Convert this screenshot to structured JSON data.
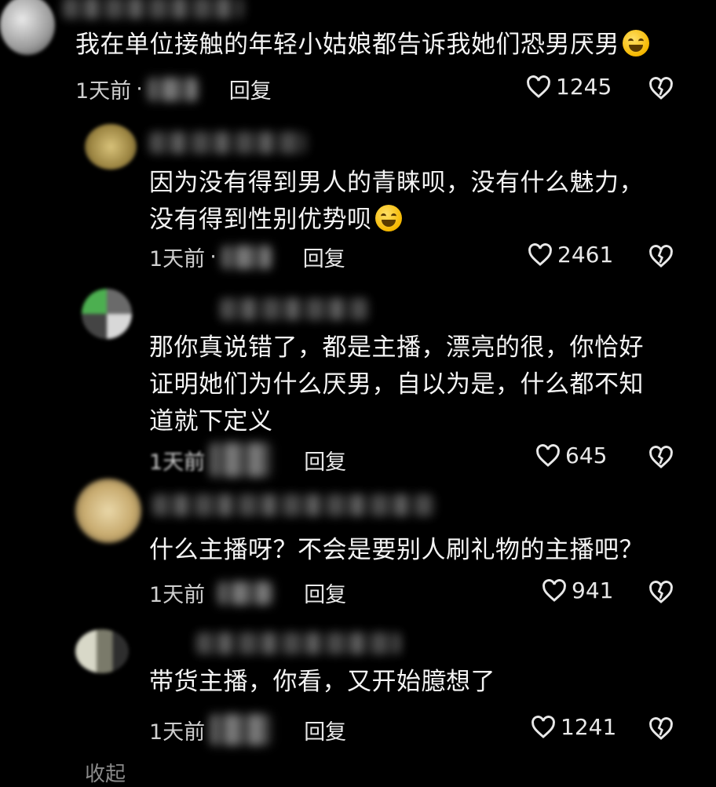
{
  "comments": [
    {
      "text_lines": [
        "我在单位接触的年轻小姑娘都告诉我她们恐男厌男"
      ],
      "emoji": "rofl-emoji",
      "time": "1天前",
      "reply": "回复",
      "likes": "1245"
    },
    {
      "text_lines": [
        "因为没有得到男人的青睐呗，没有什么魅力，",
        "没有得到性别优势呗"
      ],
      "emoji": "laughing-emoji",
      "time": "1天前",
      "reply": "回复",
      "likes": "2461"
    },
    {
      "text_lines": [
        "那你真说错了，都是主播，漂亮的很，你恰好",
        "证明她们为什么厌男，自以为是，什么都不知",
        "道就下定义"
      ],
      "time": "1天前",
      "reply": "回复",
      "likes": "645"
    },
    {
      "text_lines": [
        "什么主播呀？不会是要别人刷礼物的主播吧？"
      ],
      "time": "1天前",
      "reply": "回复",
      "likes": "941"
    },
    {
      "text_lines": [
        "带货主播，你看，又开始臆想了"
      ],
      "time": "1天前",
      "reply": "回复",
      "likes": "1241"
    }
  ],
  "footer": {
    "collapse": "收起"
  },
  "colors": {
    "background": "#000000",
    "text": "#f4f4f4",
    "meta": "#cfcfcf"
  },
  "icons": {
    "like": "heart-outline-icon",
    "dislike": "broken-heart-icon"
  }
}
